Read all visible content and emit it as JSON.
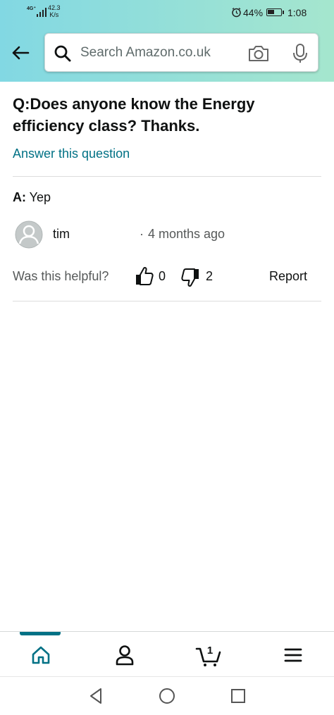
{
  "status_bar": {
    "network": "4G⁺",
    "speed_value": "42.3",
    "speed_unit": "K/s",
    "battery": "44%",
    "time": "1:08"
  },
  "header": {
    "back_icon": "arrow-left-icon",
    "search_placeholder": "Search Amazon.co.uk",
    "camera_icon": "camera-icon",
    "mic_icon": "microphone-icon"
  },
  "question": {
    "text": "Q:Does anyone know the Energy efficiency class? Thanks.",
    "answer_link": "Answer this question"
  },
  "answer": {
    "prefix": "A:",
    "text": " Yep",
    "author": "tim",
    "separator": "·",
    "time_ago": "4 months ago",
    "helpful_label": "Was this helpful?",
    "upvotes": "0",
    "downvotes": "2",
    "report_label": "Report"
  },
  "bottom_nav": {
    "items": [
      "home-icon",
      "account-icon",
      "cart-icon",
      "menu-icon"
    ],
    "cart_count": "1",
    "active_color": "#007185"
  },
  "system_nav": [
    "back-triangle-icon",
    "home-circle-icon",
    "recents-square-icon"
  ]
}
